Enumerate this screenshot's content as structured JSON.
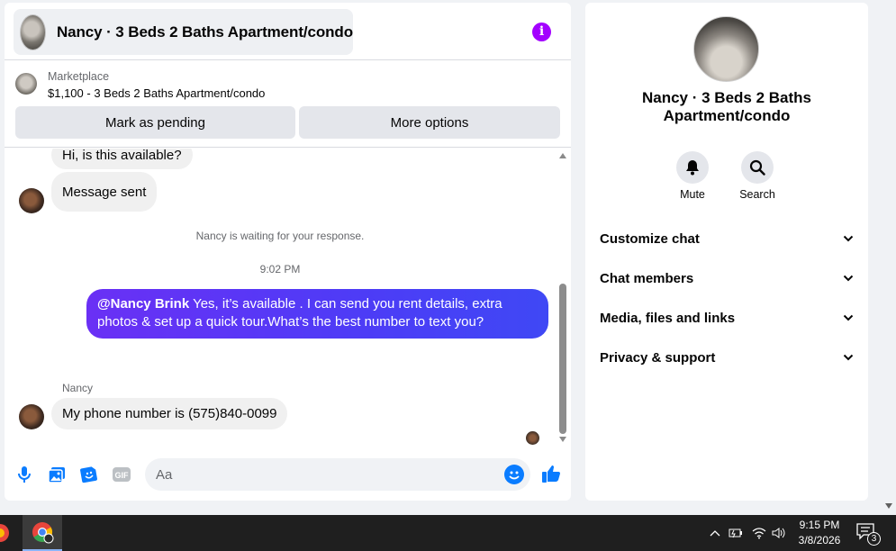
{
  "chat": {
    "title": "Nancy · 3 Beds 2 Baths Apartment/condo",
    "listing": {
      "category": "Marketplace",
      "price_title": "$1,100 - 3 Beds 2 Baths Apartment/condo"
    },
    "buttons": {
      "mark_pending": "Mark as pending",
      "more_options": "More options"
    },
    "messages": {
      "incoming_1": "Hi, is this available?",
      "incoming_2": "Message sent",
      "waiting_notice": "Nancy is waiting for your response.",
      "timestamp": "9:02 PM",
      "outgoing_mention": "@Nancy Brink",
      "outgoing_text": " Yes, it’s available .  I can send you rent details, extra photos & set up a quick tour.What’s the best number to text you?",
      "sender_name": "Nancy",
      "incoming_3": "My phone number is (575)840-0099"
    },
    "composer": {
      "placeholder": "Aa",
      "gif_label": "GIF"
    }
  },
  "info_panel": {
    "name": "Nancy · 3 Beds 2 Baths Apartment/condo",
    "actions": {
      "mute": "Mute",
      "search": "Search"
    },
    "sections": [
      "Customize chat",
      "Chat members",
      "Media, files and links",
      "Privacy & support"
    ]
  },
  "taskbar": {
    "time": "9:15 PM",
    "date": "3/8/2026",
    "notification_count": "3"
  },
  "colors": {
    "accent_blue": "#0a7cff",
    "outgoing_bubble": "#4d3cf6",
    "info_purple": "#a300ff"
  }
}
